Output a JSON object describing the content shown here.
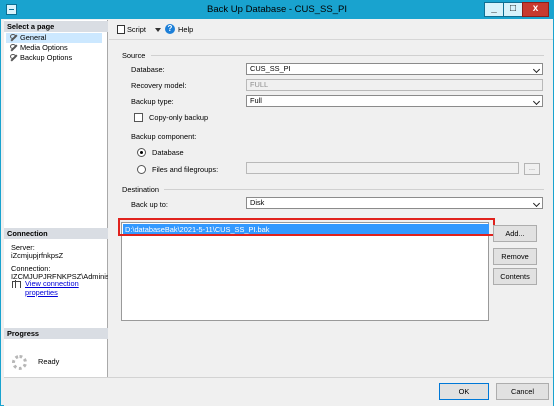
{
  "window": {
    "title": "Back Up Database - CUS_SS_PI",
    "controls": {
      "minimize": "_",
      "maximize": "□",
      "close": "x"
    }
  },
  "sidebar": {
    "select_page_title": "Select a page",
    "items": [
      {
        "label": "General",
        "selected": true,
        "icon": "wrench-icon"
      },
      {
        "label": "Media Options",
        "selected": false,
        "icon": "wrench-icon"
      },
      {
        "label": "Backup Options",
        "selected": false,
        "icon": "wrench-icon"
      }
    ],
    "connection": {
      "title": "Connection",
      "server_label": "Server:",
      "server_value": "iZcmjupjrfnkpsZ",
      "connection_label": "Connection:",
      "connection_value": "IZCMJUPJRFNKPSZ\\Administrato",
      "link": "View connection properties",
      "link_icon": "connection-icon"
    },
    "progress": {
      "title": "Progress",
      "status": "Ready",
      "icon": "spinner-icon"
    }
  },
  "toolbar": {
    "script_label": "Script",
    "help_label": "Help",
    "script_icon": "script-icon",
    "help_icon": "help-icon"
  },
  "source": {
    "title": "Source",
    "database_label": "Database:",
    "database_value": "CUS_SS_PI",
    "recovery_label": "Recovery model:",
    "recovery_value": "FULL",
    "backup_type_label": "Backup type:",
    "backup_type_value": "Full",
    "copy_only_label": "Copy-only backup",
    "backup_component_label": "Backup component:",
    "database_radio_label": "Database",
    "files_radio_label": "Files and filegroups:",
    "browse_label": "...",
    "database_radio_selected": true
  },
  "destination": {
    "title": "Destination",
    "backup_to_label": "Back up to:",
    "backup_to_value": "Disk",
    "items": [
      "D:\\databaseBak\\2021-5-11\\CUS_SS_PI.bak"
    ]
  },
  "actions": {
    "add": "Add...",
    "remove": "Remove",
    "contents": "Contents",
    "ok": "OK",
    "cancel": "Cancel"
  }
}
